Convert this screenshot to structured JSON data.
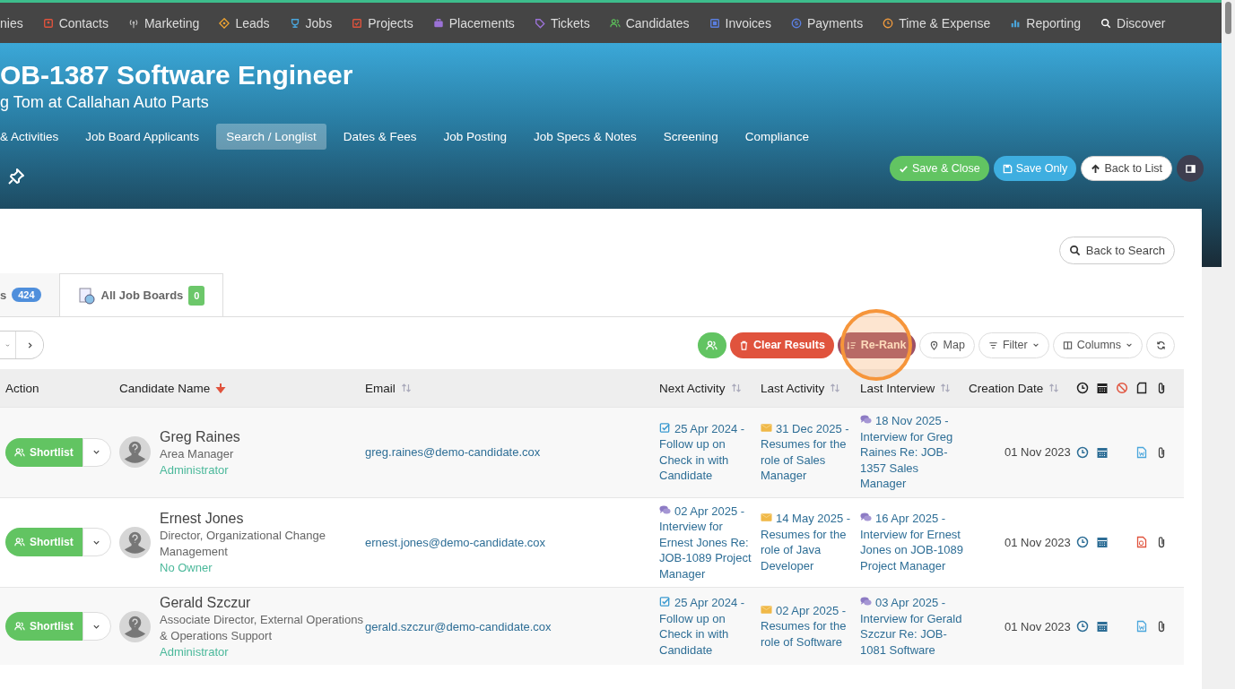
{
  "top_nav": [
    {
      "label": "nies"
    },
    {
      "label": "Contacts"
    },
    {
      "label": "Marketing"
    },
    {
      "label": "Leads"
    },
    {
      "label": "Jobs"
    },
    {
      "label": "Projects"
    },
    {
      "label": "Placements"
    },
    {
      "label": "Tickets"
    },
    {
      "label": "Candidates"
    },
    {
      "label": "Invoices"
    },
    {
      "label": "Payments"
    },
    {
      "label": "Time & Expense"
    },
    {
      "label": "Reporting"
    },
    {
      "label": "Discover"
    }
  ],
  "header": {
    "title": "OB-1387 Software Engineer",
    "subtitle": "g Tom at Callahan Auto Parts",
    "tabs": [
      {
        "label": "& Activities",
        "selected": false
      },
      {
        "label": "Job Board Applicants",
        "selected": false
      },
      {
        "label": "Search / Longlist",
        "selected": true
      },
      {
        "label": "Dates & Fees",
        "selected": false
      },
      {
        "label": "Job Posting",
        "selected": false
      },
      {
        "label": "Job Specs & Notes",
        "selected": false
      },
      {
        "label": "Screening",
        "selected": false
      },
      {
        "label": "Compliance",
        "selected": false
      }
    ],
    "buttons": [
      {
        "label": "Save & Close",
        "kind": "save_close"
      },
      {
        "label": "Save Only",
        "kind": "save"
      },
      {
        "label": "Back to List",
        "kind": "back"
      }
    ]
  },
  "back_to_search": "Back to Search",
  "result_tabs": [
    {
      "label": "s",
      "count": "424",
      "color": "#4f8fdc",
      "selected": true
    },
    {
      "label": "All Job Boards",
      "count": "0",
      "color": "#6cc76a",
      "selected": false
    }
  ],
  "toolbar": {
    "clear": "Clear Results",
    "rerank": "Re-Rank",
    "map": "Map",
    "filter": "Filter",
    "columns": "Columns"
  },
  "table": {
    "columns": [
      {
        "label": "Action"
      },
      {
        "label": "Candidate Name",
        "sorted": true
      },
      {
        "label": "Email",
        "sortable": true
      },
      {
        "label": "Next Activity",
        "sortable": true
      },
      {
        "label": "Last Activity",
        "sortable": true
      },
      {
        "label": "Last Interview",
        "sortable": true
      },
      {
        "label": "Creation Date",
        "sortable": true
      }
    ],
    "rows": [
      {
        "action": "Shortlist",
        "name": "Greg Raines",
        "job_title": "Area Manager",
        "owner": "Administrator",
        "email": "greg.raines@demo-candidate.cox",
        "next_activity": {
          "kind": "task",
          "text": "25 Apr 2024 - Follow up on Check in with Candidate"
        },
        "last_activity": {
          "kind": "email",
          "text": "31 Dec 2025 - Resumes for the role of Sales Manager"
        },
        "last_interview": {
          "kind": "meeting",
          "text": "18 Nov 2025 - Interview for Greg Raines Re: JOB-1357 Sales Manager"
        },
        "created": "01 Nov 2023",
        "document": {
          "kind": "word"
        }
      },
      {
        "action": "Shortlist",
        "name": "Ernest Jones",
        "job_title": "Director, Organizational Change Management",
        "owner": "No Owner",
        "email": "ernest.jones@demo-candidate.cox",
        "next_activity": {
          "kind": "meeting",
          "text": "02 Apr 2025 - Interview for Ernest Jones Re: JOB-1089 Project Manager"
        },
        "last_activity": {
          "kind": "email",
          "text": "14 May 2025 - Resumes for the role of Java Developer"
        },
        "last_interview": {
          "kind": "meeting",
          "text": "16 Apr 2025 - Interview for Ernest Jones on JOB-1089 Project Manager"
        },
        "created": "01 Nov 2023",
        "document": {
          "kind": "pdf"
        }
      },
      {
        "action": "Shortlist",
        "name": "Gerald Szczur",
        "job_title": "Associate Director, External Operations & Operations Support",
        "owner": "Administrator",
        "email": "gerald.szczur@demo-candidate.cox",
        "next_activity": {
          "kind": "task",
          "text": "25 Apr 2024 - Follow up on Check in with Candidate"
        },
        "last_activity": {
          "kind": "email",
          "text": "02 Apr 2025 - Resumes for the role of Software"
        },
        "last_interview": {
          "kind": "meeting",
          "text": "03 Apr 2025 - Interview for Gerald Szczur Re: JOB-1081 Software"
        },
        "created": "01 Nov 2023",
        "document": {
          "kind": "word"
        }
      }
    ]
  }
}
